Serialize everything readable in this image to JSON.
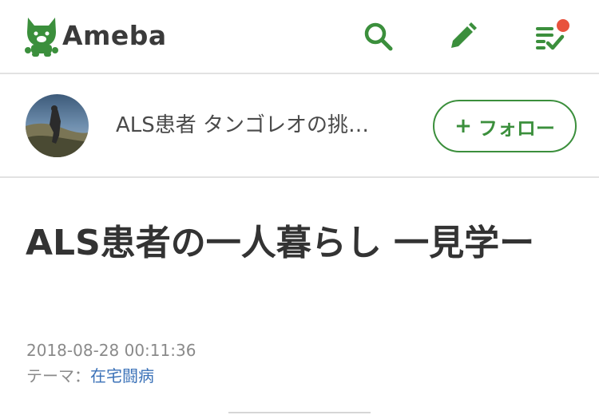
{
  "header": {
    "logo_text": "Ameba",
    "brand_color": "#3b8f3c",
    "icons": [
      "search-icon",
      "edit-icon",
      "feed-icon"
    ],
    "notification_color": "#e8523d"
  },
  "blog": {
    "name": "ALS患者 タンゴレオの挑…",
    "follow_label": "フォロー",
    "follow_plus": "+"
  },
  "article": {
    "title": "ALS患者の一人暮らし 一見学ー",
    "date": "2018-08-28 00:11:36",
    "theme_label": "テーマ：",
    "theme_value": "在宅闘病",
    "link_color": "#3b72b8"
  }
}
